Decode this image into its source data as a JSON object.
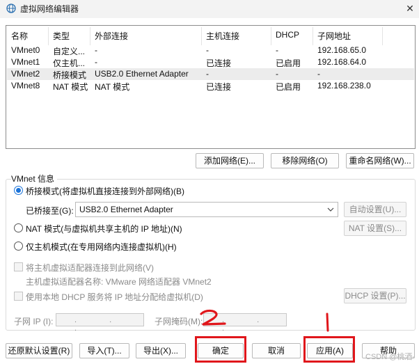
{
  "window": {
    "title": "虚拟网络编辑器",
    "close_glyph": "✕"
  },
  "network_list": {
    "columns": [
      "名称",
      "类型",
      "外部连接",
      "主机连接",
      "DHCP",
      "子网地址"
    ],
    "rows": [
      [
        "VMnet0",
        "自定义...",
        "-",
        "-",
        "-",
        "192.168.65.0"
      ],
      [
        "VMnet1",
        "仅主机...",
        "-",
        "已连接",
        "已启用",
        "192.168.64.0"
      ],
      [
        "VMnet2",
        "桥接模式",
        "USB2.0 Ethernet Adapter",
        "-",
        "-",
        "-"
      ],
      [
        "VMnet8",
        "NAT 模式",
        "NAT 模式",
        "已连接",
        "已启用",
        "192.168.238.0"
      ]
    ],
    "selected_row": 2
  },
  "list_buttons": {
    "add": "添加网络(E)...",
    "remove": "移除网络(O)",
    "rename": "重命名网络(W)..."
  },
  "vmnet_info": {
    "group_title": "VMnet 信息",
    "bridged_label": "桥接模式(将虚拟机直接连接到外部网络)(B)",
    "bridged_to_label": "已桥接至(G):",
    "bridged_to_value": "USB2.0 Ethernet Adapter",
    "auto_settings": "自动设置(U)...",
    "nat_label": "NAT 模式(与虚拟机共享主机的 IP 地址)(N)",
    "nat_settings": "NAT 设置(S)...",
    "host_only_label": "仅主机模式(在专用网络内连接虚拟机)(H)",
    "connect_adapter_label": "将主机虚拟适配器连接到此网络(V)",
    "adapter_name_label": "主机虚拟适配器名称: VMware 网络适配器 VMnet2",
    "dhcp_label": "使用本地 DHCP 服务将 IP 地址分配给虚拟机(D)",
    "dhcp_settings": "DHCP 设置(P)...",
    "subnet_ip_label": "子网 IP (I):",
    "subnet_mask_label": "子网掩码(M):",
    "ip_dots": ". . ."
  },
  "bottom_buttons": {
    "restore": "还原默认设置(R)",
    "import": "导入(T)...",
    "export": "导出(X)...",
    "ok": "确定",
    "cancel": "取消",
    "apply": "应用(A)",
    "help": "帮助"
  },
  "annotations": {
    "mark_1": "1",
    "mark_2": "2",
    "color": "#e0161b"
  },
  "watermark": "CSDN @桃酒-",
  "colors": {
    "accent": "#1a73d9",
    "selected_row_bg": "#ececec"
  }
}
